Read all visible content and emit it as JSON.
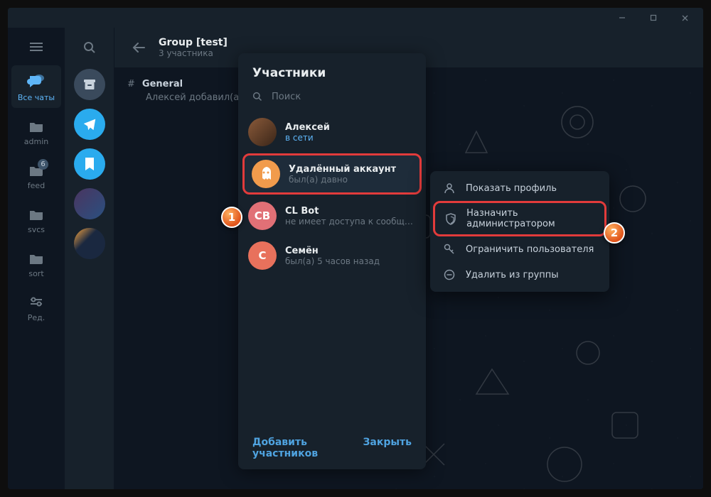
{
  "window": {
    "min": "—",
    "max": "☐",
    "close": "✕"
  },
  "rail": {
    "all_chats": "Все чаты",
    "admin": "admin",
    "feed": "feed",
    "feed_badge": "6",
    "svcs": "svcs",
    "sort": "sort",
    "edit": "Ред."
  },
  "header": {
    "title": "Group [test]",
    "subtitle": "3 участника"
  },
  "channel": {
    "hash": "#",
    "name": "General",
    "added_text": "Алексей добавил(а) с"
  },
  "dialog": {
    "title": "Участники",
    "search_placeholder": "Поиск",
    "members": [
      {
        "name": "Алексей",
        "status": "в сети",
        "online": true,
        "initials": ""
      },
      {
        "name": "Удалённый аккаунт",
        "status": "был(а) давно",
        "online": false,
        "initials": ""
      },
      {
        "name": "CL Bot",
        "status": "не имеет доступа к сообщениям",
        "online": false,
        "initials": "CB"
      },
      {
        "name": "Семён",
        "status": "был(а) 5 часов назад",
        "online": false,
        "initials": "С"
      }
    ],
    "add": "Добавить участников",
    "close": "Закрыть"
  },
  "context_menu": {
    "items": [
      {
        "label": "Показать профиль"
      },
      {
        "label": "Назначить администратором"
      },
      {
        "label": "Ограничить пользователя"
      },
      {
        "label": "Удалить из группы"
      }
    ]
  },
  "badges": {
    "one": "1",
    "two": "2"
  }
}
